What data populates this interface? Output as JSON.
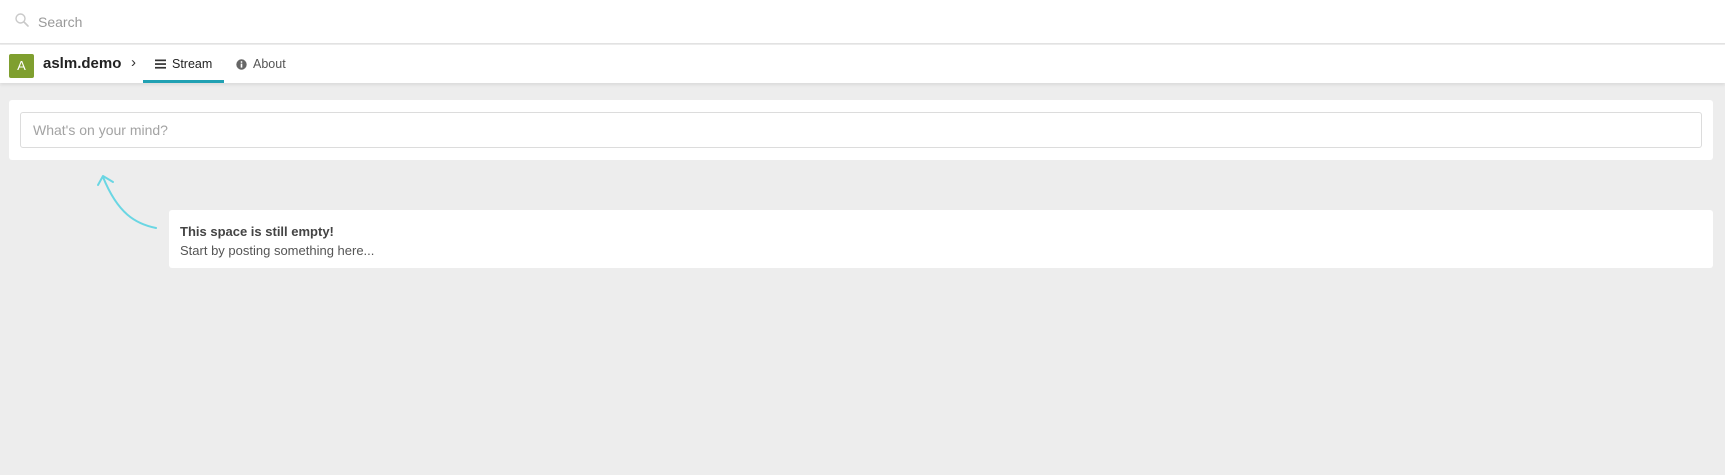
{
  "search": {
    "placeholder": "Search"
  },
  "space": {
    "avatar_letter": "A",
    "avatar_color": "#7f9f2f",
    "name": "aslm.demo",
    "separator": "›"
  },
  "tabs": [
    {
      "label": "Stream",
      "icon": "list-icon",
      "active": true
    },
    {
      "label": "About",
      "icon": "info-icon",
      "active": false
    }
  ],
  "accent_color": "#21a1b3",
  "composer": {
    "placeholder": "What's on your mind?"
  },
  "empty_state": {
    "title": "This space is still empty!",
    "text": "Start by posting something here..."
  }
}
